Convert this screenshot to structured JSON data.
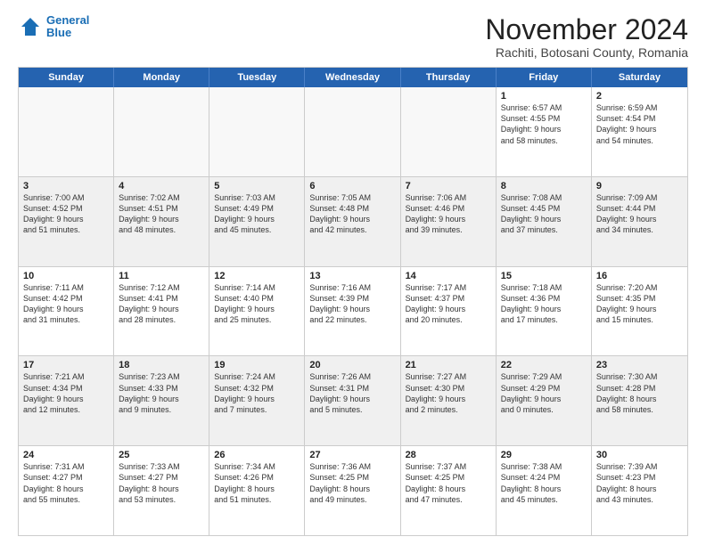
{
  "header": {
    "logo_line1": "General",
    "logo_line2": "Blue",
    "title": "November 2024",
    "subtitle": "Rachiti, Botosani County, Romania"
  },
  "weekdays": [
    "Sunday",
    "Monday",
    "Tuesday",
    "Wednesday",
    "Thursday",
    "Friday",
    "Saturday"
  ],
  "rows": [
    [
      {
        "day": "",
        "info": ""
      },
      {
        "day": "",
        "info": ""
      },
      {
        "day": "",
        "info": ""
      },
      {
        "day": "",
        "info": ""
      },
      {
        "day": "",
        "info": ""
      },
      {
        "day": "1",
        "info": "Sunrise: 6:57 AM\nSunset: 4:55 PM\nDaylight: 9 hours\nand 58 minutes."
      },
      {
        "day": "2",
        "info": "Sunrise: 6:59 AM\nSunset: 4:54 PM\nDaylight: 9 hours\nand 54 minutes."
      }
    ],
    [
      {
        "day": "3",
        "info": "Sunrise: 7:00 AM\nSunset: 4:52 PM\nDaylight: 9 hours\nand 51 minutes."
      },
      {
        "day": "4",
        "info": "Sunrise: 7:02 AM\nSunset: 4:51 PM\nDaylight: 9 hours\nand 48 minutes."
      },
      {
        "day": "5",
        "info": "Sunrise: 7:03 AM\nSunset: 4:49 PM\nDaylight: 9 hours\nand 45 minutes."
      },
      {
        "day": "6",
        "info": "Sunrise: 7:05 AM\nSunset: 4:48 PM\nDaylight: 9 hours\nand 42 minutes."
      },
      {
        "day": "7",
        "info": "Sunrise: 7:06 AM\nSunset: 4:46 PM\nDaylight: 9 hours\nand 39 minutes."
      },
      {
        "day": "8",
        "info": "Sunrise: 7:08 AM\nSunset: 4:45 PM\nDaylight: 9 hours\nand 37 minutes."
      },
      {
        "day": "9",
        "info": "Sunrise: 7:09 AM\nSunset: 4:44 PM\nDaylight: 9 hours\nand 34 minutes."
      }
    ],
    [
      {
        "day": "10",
        "info": "Sunrise: 7:11 AM\nSunset: 4:42 PM\nDaylight: 9 hours\nand 31 minutes."
      },
      {
        "day": "11",
        "info": "Sunrise: 7:12 AM\nSunset: 4:41 PM\nDaylight: 9 hours\nand 28 minutes."
      },
      {
        "day": "12",
        "info": "Sunrise: 7:14 AM\nSunset: 4:40 PM\nDaylight: 9 hours\nand 25 minutes."
      },
      {
        "day": "13",
        "info": "Sunrise: 7:16 AM\nSunset: 4:39 PM\nDaylight: 9 hours\nand 22 minutes."
      },
      {
        "day": "14",
        "info": "Sunrise: 7:17 AM\nSunset: 4:37 PM\nDaylight: 9 hours\nand 20 minutes."
      },
      {
        "day": "15",
        "info": "Sunrise: 7:18 AM\nSunset: 4:36 PM\nDaylight: 9 hours\nand 17 minutes."
      },
      {
        "day": "16",
        "info": "Sunrise: 7:20 AM\nSunset: 4:35 PM\nDaylight: 9 hours\nand 15 minutes."
      }
    ],
    [
      {
        "day": "17",
        "info": "Sunrise: 7:21 AM\nSunset: 4:34 PM\nDaylight: 9 hours\nand 12 minutes."
      },
      {
        "day": "18",
        "info": "Sunrise: 7:23 AM\nSunset: 4:33 PM\nDaylight: 9 hours\nand 9 minutes."
      },
      {
        "day": "19",
        "info": "Sunrise: 7:24 AM\nSunset: 4:32 PM\nDaylight: 9 hours\nand 7 minutes."
      },
      {
        "day": "20",
        "info": "Sunrise: 7:26 AM\nSunset: 4:31 PM\nDaylight: 9 hours\nand 5 minutes."
      },
      {
        "day": "21",
        "info": "Sunrise: 7:27 AM\nSunset: 4:30 PM\nDaylight: 9 hours\nand 2 minutes."
      },
      {
        "day": "22",
        "info": "Sunrise: 7:29 AM\nSunset: 4:29 PM\nDaylight: 9 hours\nand 0 minutes."
      },
      {
        "day": "23",
        "info": "Sunrise: 7:30 AM\nSunset: 4:28 PM\nDaylight: 8 hours\nand 58 minutes."
      }
    ],
    [
      {
        "day": "24",
        "info": "Sunrise: 7:31 AM\nSunset: 4:27 PM\nDaylight: 8 hours\nand 55 minutes."
      },
      {
        "day": "25",
        "info": "Sunrise: 7:33 AM\nSunset: 4:27 PM\nDaylight: 8 hours\nand 53 minutes."
      },
      {
        "day": "26",
        "info": "Sunrise: 7:34 AM\nSunset: 4:26 PM\nDaylight: 8 hours\nand 51 minutes."
      },
      {
        "day": "27",
        "info": "Sunrise: 7:36 AM\nSunset: 4:25 PM\nDaylight: 8 hours\nand 49 minutes."
      },
      {
        "day": "28",
        "info": "Sunrise: 7:37 AM\nSunset: 4:25 PM\nDaylight: 8 hours\nand 47 minutes."
      },
      {
        "day": "29",
        "info": "Sunrise: 7:38 AM\nSunset: 4:24 PM\nDaylight: 8 hours\nand 45 minutes."
      },
      {
        "day": "30",
        "info": "Sunrise: 7:39 AM\nSunset: 4:23 PM\nDaylight: 8 hours\nand 43 minutes."
      }
    ]
  ]
}
